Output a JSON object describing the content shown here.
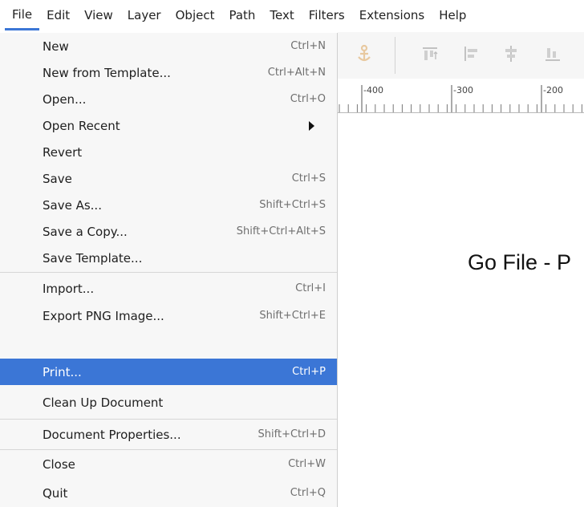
{
  "menubar": {
    "items": [
      "File",
      "Edit",
      "View",
      "Layer",
      "Object",
      "Path",
      "Text",
      "Filters",
      "Extensions",
      "Help"
    ],
    "active": "File"
  },
  "file_menu": {
    "items": [
      {
        "label": "New",
        "shortcut": "Ctrl+N"
      },
      {
        "label": "New from Template...",
        "shortcut": "Ctrl+Alt+N"
      },
      {
        "label": "Open...",
        "shortcut": "Ctrl+O"
      },
      {
        "label": "Open Recent",
        "shortcut": ""
      },
      {
        "label": "Revert",
        "shortcut": ""
      },
      {
        "label": "Save",
        "shortcut": "Ctrl+S"
      },
      {
        "label": "Save As...",
        "shortcut": "Shift+Ctrl+S"
      },
      {
        "label": "Save a Copy...",
        "shortcut": "Shift+Ctrl+Alt+S"
      },
      {
        "label": "Save Template...",
        "shortcut": ""
      },
      {
        "label": "Import...",
        "shortcut": "Ctrl+I"
      },
      {
        "label": "Export PNG Image...",
        "shortcut": "Shift+Ctrl+E"
      },
      {
        "label": "Print...",
        "shortcut": "Ctrl+P"
      },
      {
        "label": "Clean Up Document",
        "shortcut": ""
      },
      {
        "label": "Document Properties...",
        "shortcut": "Shift+Ctrl+D"
      },
      {
        "label": "Close",
        "shortcut": "Ctrl+W"
      },
      {
        "label": "Quit",
        "shortcut": "Ctrl+Q"
      }
    ],
    "highlighted": "Print..."
  },
  "ruler": {
    "labels": [
      "-400",
      "-300",
      "-200"
    ]
  },
  "caption": {
    "text": "Go File - P"
  },
  "colors": {
    "accent": "#3b76d6"
  }
}
